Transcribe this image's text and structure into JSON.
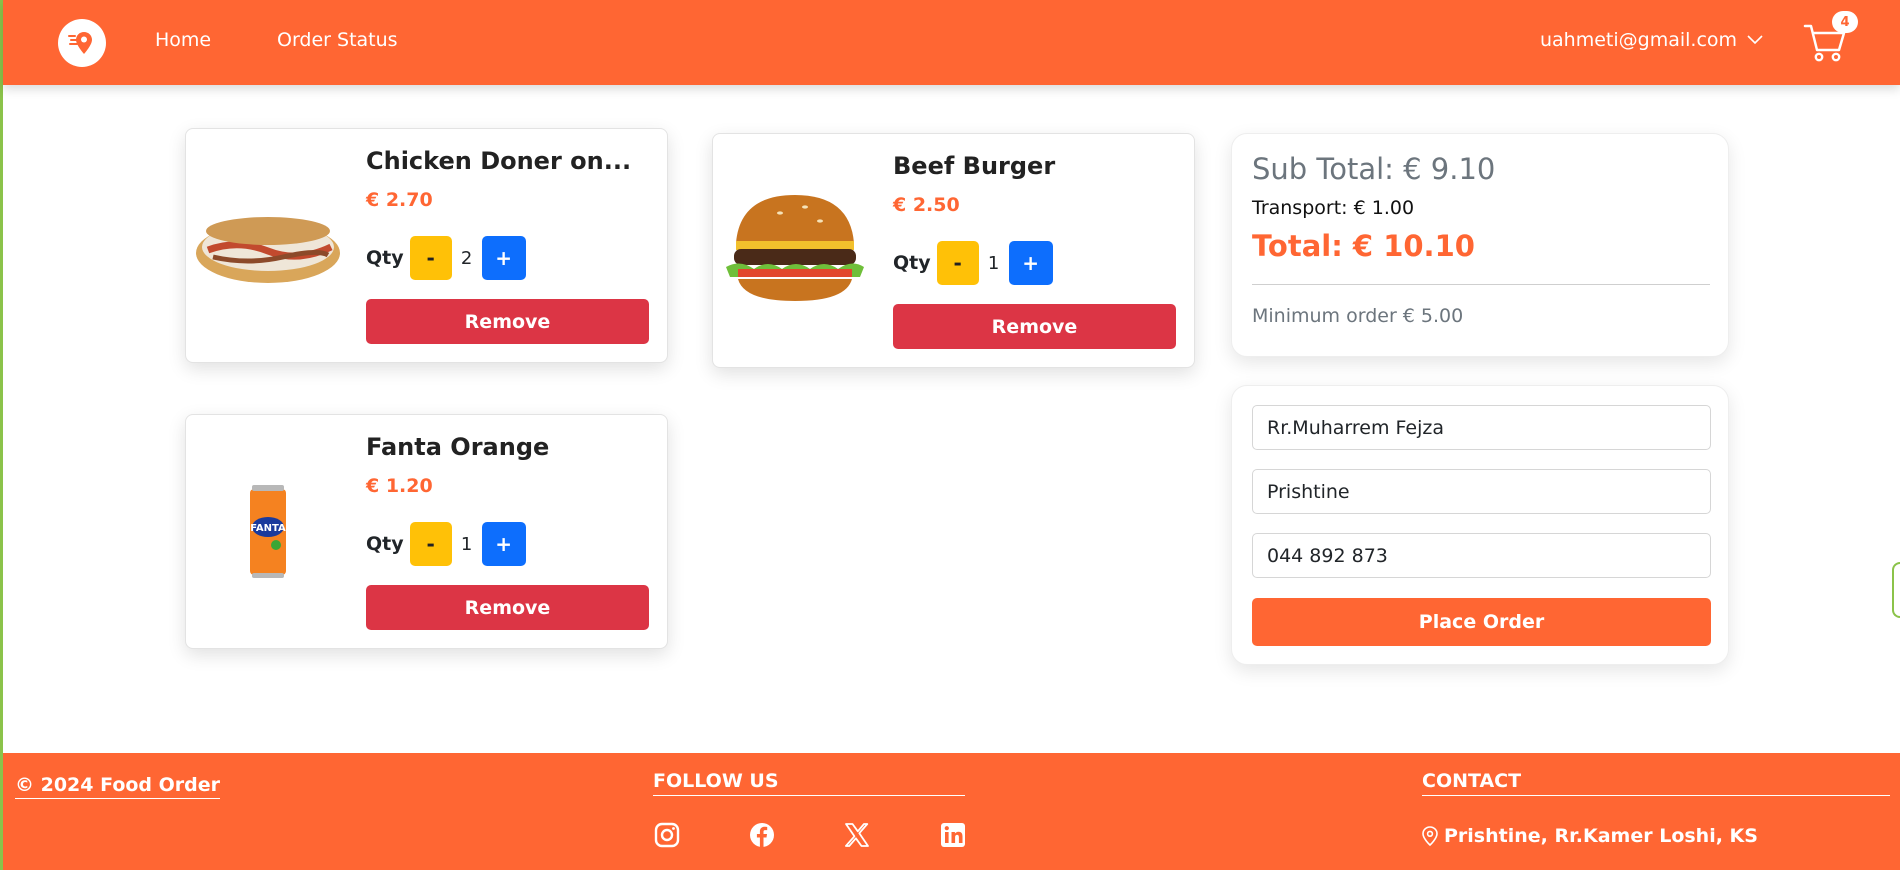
{
  "nav": {
    "links": [
      "Home",
      "Order Status"
    ],
    "user_email": "uahmeti@gmail.com",
    "cart_count": "4"
  },
  "cart": {
    "items": [
      {
        "name": "Chicken Doner on...",
        "price": "€ 2.70",
        "qty_label": "Qty",
        "qty": "2",
        "minus": "-",
        "plus": "+",
        "remove_label": "Remove"
      },
      {
        "name": "Beef Burger",
        "price": "€ 2.50",
        "qty_label": "Qty",
        "qty": "1",
        "minus": "-",
        "plus": "+",
        "remove_label": "Remove"
      },
      {
        "name": "Fanta Orange",
        "price": "€ 1.20",
        "qty_label": "Qty",
        "qty": "1",
        "minus": "-",
        "plus": "+",
        "remove_label": "Remove"
      }
    ]
  },
  "summary": {
    "sub_total": "Sub Total: € 9.10",
    "transport": "Transport: € 1.00",
    "total": "Total: € 10.10",
    "minimum": "Minimum order € 5.00"
  },
  "order_form": {
    "street": "Rr.Muharrem Fejza",
    "city": "Prishtine",
    "phone": "044 892 873",
    "place_order_label": "Place Order"
  },
  "footer": {
    "copyright": "© 2024 Food Order",
    "follow_heading": "FOLLOW US",
    "contact_heading": "CONTACT",
    "address": "Prishtine, Rr.Kamer Loshi, KS",
    "social_icons": [
      "instagram-icon",
      "facebook-icon",
      "x-twitter-icon",
      "linkedin-icon"
    ]
  },
  "colors": {
    "brand": "#ff6633",
    "minus_button": "#ffc107",
    "plus_button": "#0d6efd",
    "remove_button": "#dc3545"
  }
}
